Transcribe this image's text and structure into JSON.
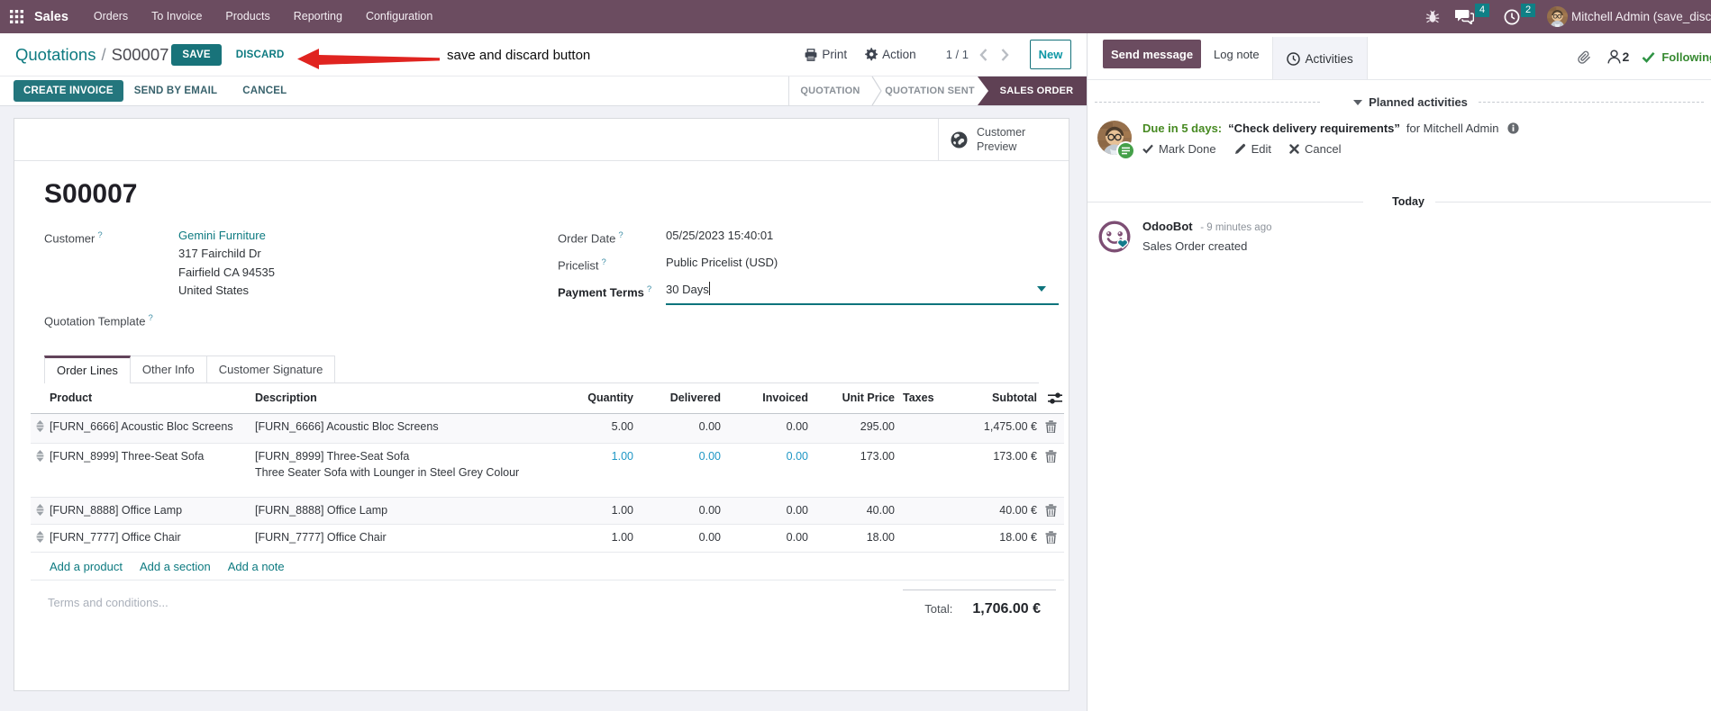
{
  "colors": {
    "brand_plum": "#6b4c60",
    "active_step_plum": "#5f4154",
    "teal_button": "#18737a",
    "teal_link": "#0d7a80",
    "highlight_blue": "#17a2c6",
    "success_green": "#2e9344",
    "activity_due_green": "#47831d",
    "annotation_red": "#e02420"
  },
  "navbar": {
    "app_name": "Sales",
    "menus": [
      "Orders",
      "To Invoice",
      "Products",
      "Reporting",
      "Configuration"
    ],
    "message_badge": "4",
    "activity_badge": "2",
    "user_name": "Mitchell Admin (save_discard"
  },
  "control_panel": {
    "breadcrumb_parent": "Quotations",
    "breadcrumb_sep": "/",
    "breadcrumb_current": "S00007",
    "save_label": "SAVE",
    "discard_label": "DISCARD",
    "annotation_text": "save and discard button",
    "print_label": "Print",
    "action_label": "Action",
    "pager_value": "1 / 1",
    "new_label": "New"
  },
  "status_buttons": {
    "create_invoice": "CREATE INVOICE",
    "send_by_email": "SEND BY EMAIL",
    "cancel": "CANCEL"
  },
  "statusbar_steps": {
    "step1": "QUOTATION",
    "step2": "QUOTATION SENT",
    "step3": "SALES ORDER"
  },
  "sheet": {
    "preview_line1": "Customer",
    "preview_line2": "Preview",
    "title": "S00007",
    "customer_label": "Customer",
    "customer_name": "Gemini Furniture",
    "address_line1": "317 Fairchild Dr",
    "address_line2": "Fairfield CA 94535",
    "address_line3": "United States",
    "quotation_template_label": "Quotation Template",
    "order_date_label": "Order Date",
    "order_date_value": "05/25/2023 15:40:01",
    "pricelist_label": "Pricelist",
    "pricelist_value": "Public Pricelist (USD)",
    "payment_terms_label": "Payment Terms",
    "payment_terms_value": "30 Days",
    "tab_order_lines": "Order Lines",
    "tab_other_info": "Other Info",
    "tab_customer_signature": "Customer Signature",
    "notes_placeholder": "Terms and conditions...",
    "total_label": "Total:",
    "total_value": "1,706.00 €"
  },
  "order_lines": {
    "columns": {
      "product": "Product",
      "description": "Description",
      "quantity": "Quantity",
      "delivered": "Delivered",
      "invoiced": "Invoiced",
      "unit_price": "Unit Price",
      "taxes": "Taxes",
      "subtotal": "Subtotal"
    },
    "rows": [
      {
        "product": "[FURN_6666] Acoustic Bloc Screens",
        "description": "[FURN_6666] Acoustic Bloc Screens",
        "description2": "",
        "quantity": "5.00",
        "delivered": "0.00",
        "invoiced": "0.00",
        "unit_price": "295.00",
        "taxes": "",
        "subtotal": "1,475.00 €",
        "highlight": false
      },
      {
        "product": "[FURN_8999] Three-Seat Sofa",
        "description": "[FURN_8999] Three-Seat Sofa",
        "description2": "Three Seater Sofa with Lounger in Steel Grey Colour",
        "quantity": "1.00",
        "delivered": "0.00",
        "invoiced": "0.00",
        "unit_price": "173.00",
        "taxes": "",
        "subtotal": "173.00 €",
        "highlight": true
      },
      {
        "product": "[FURN_8888] Office Lamp",
        "description": "[FURN_8888] Office Lamp",
        "description2": "",
        "quantity": "1.00",
        "delivered": "0.00",
        "invoiced": "0.00",
        "unit_price": "40.00",
        "taxes": "",
        "subtotal": "40.00 €",
        "highlight": false
      },
      {
        "product": "[FURN_7777] Office Chair",
        "description": "[FURN_7777] Office Chair",
        "description2": "",
        "quantity": "1.00",
        "delivered": "0.00",
        "invoiced": "0.00",
        "unit_price": "18.00",
        "taxes": "",
        "subtotal": "18.00 €",
        "highlight": false
      }
    ],
    "add_product": "Add a product",
    "add_section": "Add a section",
    "add_note": "Add a note"
  },
  "chatter": {
    "send_message": "Send message",
    "log_note": "Log note",
    "activities": "Activities",
    "follower_count": "2",
    "following_label": "Following",
    "planned_activities": "Planned activities",
    "activity_due": "Due in 5 days:",
    "activity_summary": "“Check delivery requirements”",
    "activity_assignee": "for Mitchell Admin",
    "mark_done": "Mark Done",
    "edit": "Edit",
    "cancel": "Cancel",
    "today": "Today",
    "msg_author": "OdooBot",
    "msg_time": "- 9 minutes ago",
    "msg_body": "Sales Order created"
  }
}
